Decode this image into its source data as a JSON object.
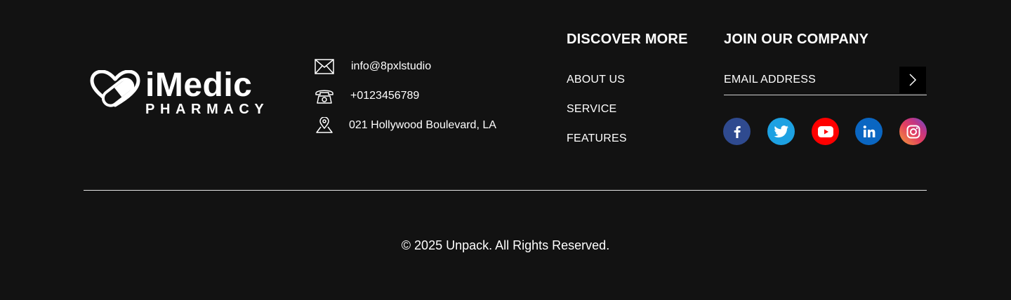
{
  "logo": {
    "word": "iMedic",
    "sub": "PHARMACY"
  },
  "contact": {
    "email": "info@8pxlstudio",
    "phone": "+0123456789",
    "address": "021 Hollywood Boulevard, LA"
  },
  "discover": {
    "title": "DISCOVER MORE",
    "links": [
      "ABOUT US",
      "SERVICE",
      "FEATURES"
    ]
  },
  "join": {
    "title": "JOIN OUR COMPANY",
    "email_placeholder": "EMAIL ADDRESS"
  },
  "social": [
    {
      "icon": "facebook-icon",
      "color": "#2f4a8f"
    },
    {
      "icon": "twitter-icon",
      "color": "#1da1e2"
    },
    {
      "icon": "youtube-icon",
      "color": "#ff0000"
    },
    {
      "icon": "linkedin-icon",
      "color": "#0a66c2"
    },
    {
      "icon": "instagram-icon",
      "color": "#c13584"
    }
  ],
  "footer": {
    "copyright": "© 2025 Unpack. All Rights Reserved."
  }
}
